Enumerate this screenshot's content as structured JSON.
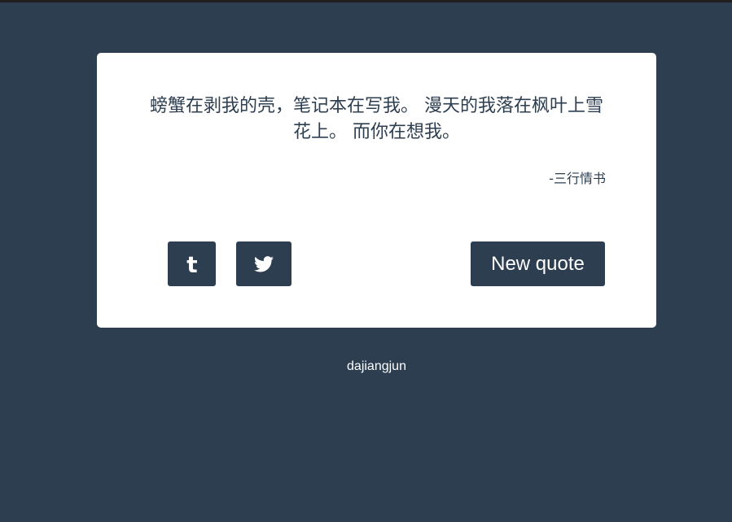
{
  "quote": {
    "text": "螃蟹在剥我的壳，笔记本在写我。 漫天的我落在枫叶上雪花上。 而你在想我。",
    "author": "-三行情书"
  },
  "actions": {
    "tumblr_icon": "tumblr-icon",
    "twitter_icon": "twitter-icon",
    "new_quote_label": "New quote"
  },
  "footer": {
    "credit": "dajiangjun"
  },
  "colors": {
    "background": "#2c3e50",
    "card": "#ffffff",
    "accent": "#2c3e50"
  }
}
